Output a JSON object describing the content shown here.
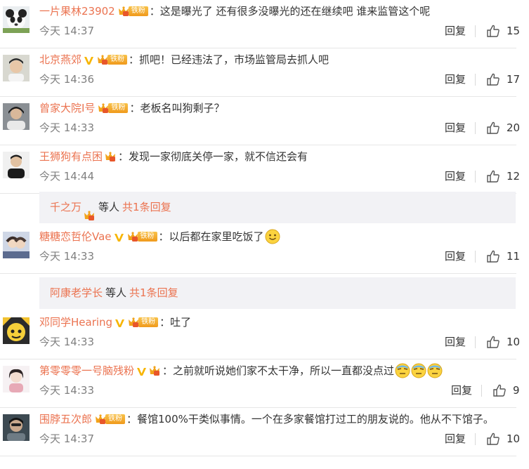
{
  "comments": [
    {
      "user": "一片果林23902",
      "vip": false,
      "fan_label": "铁粉",
      "crown": true,
      "text": "：这是曝光了  还有很多没曝光的还在继续吧  谁来监管这个呢",
      "time": "今天 14:37",
      "reply": "回复",
      "likes": "15",
      "emoji": []
    },
    {
      "user": "北京燕郊",
      "vip": true,
      "fan_label": "铁粉",
      "crown": true,
      "text": "：抓吧！已经违法了，市场监管局去抓人吧",
      "time": "今天 14:36",
      "reply": "回复",
      "likes": "17",
      "emoji": []
    },
    {
      "user": "曾家大院I号",
      "vip": false,
      "fan_label": "铁粉",
      "crown": true,
      "text": "：老板名叫狗剩子？",
      "time": "今天 14:33",
      "reply": "回复",
      "likes": "20",
      "emoji": []
    },
    {
      "user": "王狮狗有点困",
      "vip": false,
      "fan_label": "",
      "crown": true,
      "text": "：发现一家彻底关停一家，就不信还会有",
      "time": "今天 14:44",
      "reply": "回复",
      "likes": "12",
      "emoji": []
    },
    {
      "user": "糖糖恋哲伦Vae",
      "vip": true,
      "fan_label": "铁粉",
      "crown": true,
      "text": "：以后都在家里吃饭了",
      "time": "今天 14:33",
      "reply": "回复",
      "likes": "11",
      "emoji": [
        "smile-emoji"
      ]
    },
    {
      "user": "邓同学Hearing",
      "vip": true,
      "fan_label": "铁粉",
      "crown": true,
      "text": "：吐了",
      "time": "今天 14:33",
      "reply": "回复",
      "likes": "10",
      "emoji": []
    },
    {
      "user": "第零零零一号脑残粉",
      "vip": true,
      "fan_label": "",
      "crown": true,
      "text": "：之前就听说她们家不太干净，所以一直都没点过",
      "time": "今天 14:33",
      "reply": "回复",
      "likes": "9",
      "emoji": [
        "sweat-emoji",
        "sweat-emoji",
        "sweat-emoji"
      ]
    },
    {
      "user": "围脖五次郎",
      "vip": false,
      "fan_label": "铁粉",
      "crown": true,
      "text": "：餐馆100%干类似事情。一个在多家餐馆打过工的朋友说的。他从不下馆子。",
      "time": "今天 14:37",
      "reply": "回复",
      "likes": "10",
      "emoji": []
    }
  ],
  "sub_replies": [
    {
      "user": "千之万",
      "crown": true,
      "etc": "等人",
      "total": "共1条回复"
    },
    {
      "user": "阿康老学长",
      "crown": false,
      "etc": "等人",
      "total": "共1条回复"
    }
  ],
  "colors": {
    "username": "#eb7350",
    "time": "#808080",
    "divider": "#e6e6e6",
    "subbox": "#f2f2f5",
    "vip": "#f7b500",
    "fan_badge": "#f5a623"
  }
}
